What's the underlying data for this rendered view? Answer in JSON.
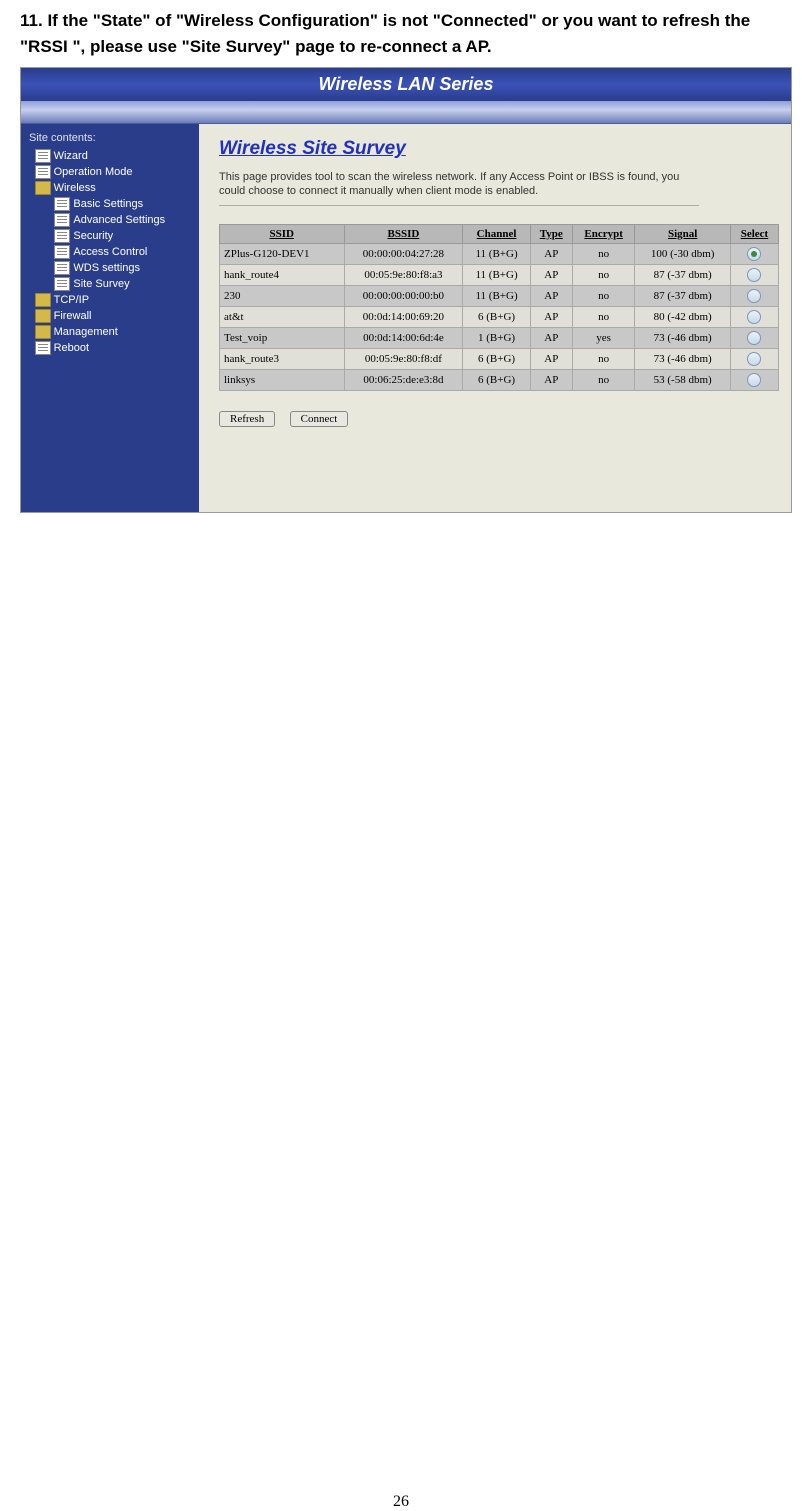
{
  "doc_instruction": {
    "number": "11.",
    "text": "If the \"State\" of \"Wireless Configuration\" is not \"Connected\" or you want to refresh the \"RSSI \", please use \"Site Survey\" page to re-connect a AP."
  },
  "app_title": "Wireless LAN Series",
  "sidebar": {
    "title": "Site contents:",
    "items": [
      {
        "label": "Wizard",
        "type": "doc",
        "indent": 0
      },
      {
        "label": "Operation Mode",
        "type": "doc",
        "indent": 0
      },
      {
        "label": "Wireless",
        "type": "folder",
        "indent": 0
      },
      {
        "label": "Basic Settings",
        "type": "doc",
        "indent": 1
      },
      {
        "label": "Advanced Settings",
        "type": "doc",
        "indent": 1
      },
      {
        "label": "Security",
        "type": "doc",
        "indent": 1
      },
      {
        "label": "Access Control",
        "type": "doc",
        "indent": 1
      },
      {
        "label": "WDS settings",
        "type": "doc",
        "indent": 1
      },
      {
        "label": "Site Survey",
        "type": "doc",
        "indent": 1
      },
      {
        "label": "TCP/IP",
        "type": "folder",
        "indent": 0
      },
      {
        "label": "Firewall",
        "type": "folder",
        "indent": 0
      },
      {
        "label": "Management",
        "type": "folder",
        "indent": 0
      },
      {
        "label": "Reboot",
        "type": "doc",
        "indent": 0
      }
    ]
  },
  "content": {
    "title": "Wireless Site Survey",
    "description": "This page provides tool to scan the wireless network. If any Access Point or IBSS is found, you could choose to connect it manually when client mode is enabled."
  },
  "table": {
    "headers": [
      "SSID",
      "BSSID",
      "Channel",
      "Type",
      "Encrypt",
      "Signal",
      "Select"
    ],
    "rows": [
      {
        "ssid": "ZPlus-G120-DEV1",
        "bssid": "00:00:00:04:27:28",
        "channel": "11 (B+G)",
        "type": "AP",
        "encrypt": "no",
        "signal": "100 (-30 dbm)",
        "selected": true
      },
      {
        "ssid": "hank_route4",
        "bssid": "00:05:9e:80:f8:a3",
        "channel": "11 (B+G)",
        "type": "AP",
        "encrypt": "no",
        "signal": "87 (-37 dbm)",
        "selected": false
      },
      {
        "ssid": "230",
        "bssid": "00:00:00:00:00:b0",
        "channel": "11 (B+G)",
        "type": "AP",
        "encrypt": "no",
        "signal": "87 (-37 dbm)",
        "selected": false
      },
      {
        "ssid": "at&t",
        "bssid": "00:0d:14:00:69:20",
        "channel": "6 (B+G)",
        "type": "AP",
        "encrypt": "no",
        "signal": "80 (-42 dbm)",
        "selected": false
      },
      {
        "ssid": "Test_voip",
        "bssid": "00:0d:14:00:6d:4e",
        "channel": "1 (B+G)",
        "type": "AP",
        "encrypt": "yes",
        "signal": "73 (-46 dbm)",
        "selected": false
      },
      {
        "ssid": "hank_route3",
        "bssid": "00:05:9e:80:f8:df",
        "channel": "6 (B+G)",
        "type": "AP",
        "encrypt": "no",
        "signal": "73 (-46 dbm)",
        "selected": false
      },
      {
        "ssid": "linksys",
        "bssid": "00:06:25:de:e3:8d",
        "channel": "6 (B+G)",
        "type": "AP",
        "encrypt": "no",
        "signal": "53 (-58 dbm)",
        "selected": false
      }
    ]
  },
  "buttons": {
    "refresh": "Refresh",
    "connect": "Connect"
  },
  "page_number": "26"
}
